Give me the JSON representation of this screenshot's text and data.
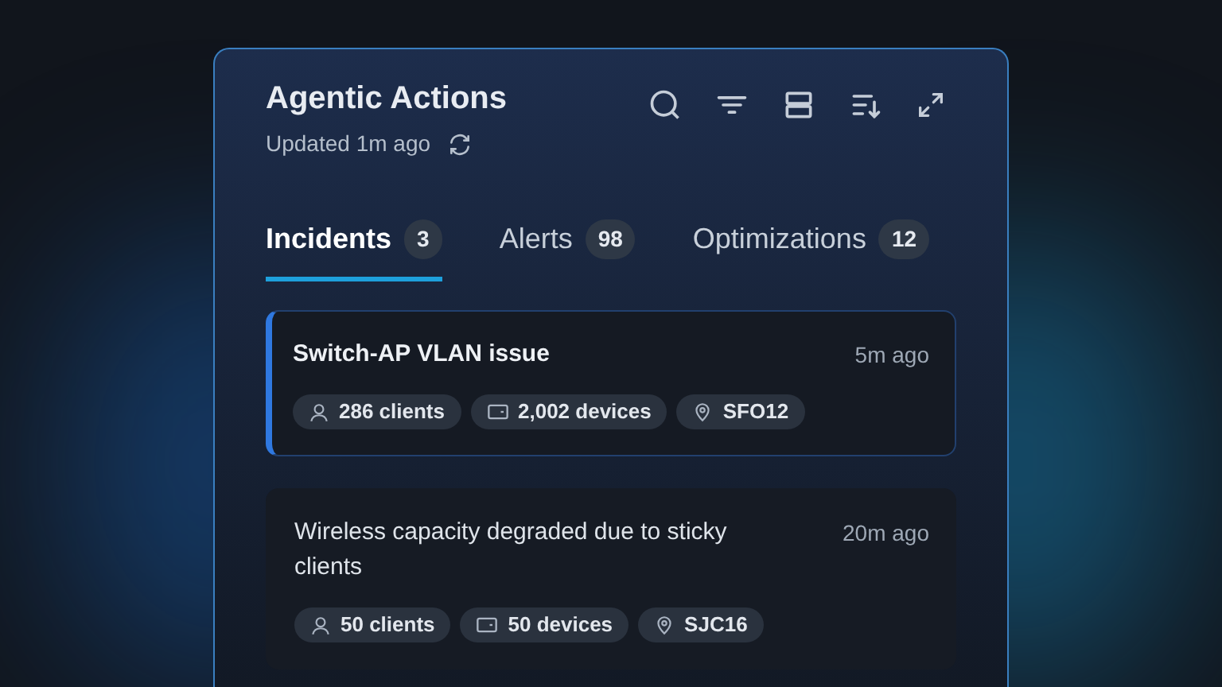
{
  "panel": {
    "title": "Agentic Actions",
    "updated": "Updated 1m ago"
  },
  "tabs": [
    {
      "label": "Incidents",
      "count": "3",
      "selected": true
    },
    {
      "label": "Alerts",
      "count": "98",
      "selected": false
    },
    {
      "label": "Optimizations",
      "count": "12",
      "selected": false
    }
  ],
  "incidents": [
    {
      "title": "Switch-AP VLAN issue",
      "time": "5m ago",
      "selected": true,
      "tags": [
        {
          "kind": "clients",
          "label": "286 clients"
        },
        {
          "kind": "devices",
          "label": "2,002 devices"
        },
        {
          "kind": "site",
          "label": "SFO12"
        }
      ]
    },
    {
      "title": "Wireless capacity degraded due to sticky clients",
      "time": "20m ago",
      "selected": false,
      "tags": [
        {
          "kind": "clients",
          "label": "50 clients"
        },
        {
          "kind": "devices",
          "label": "50 devices"
        },
        {
          "kind": "site",
          "label": "SJC16"
        }
      ]
    }
  ]
}
